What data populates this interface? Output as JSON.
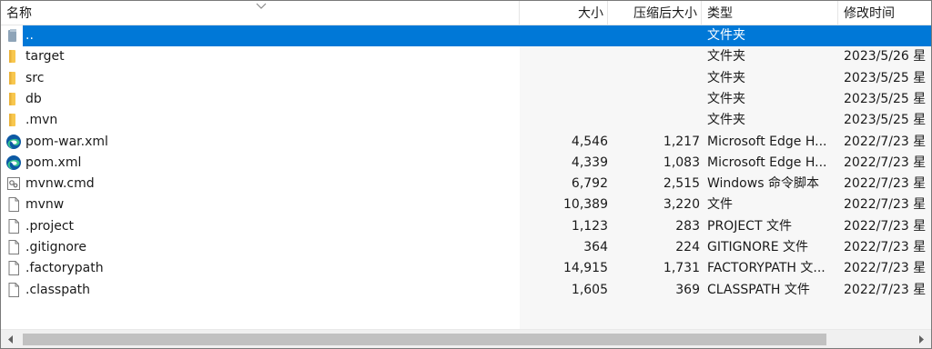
{
  "header": {
    "col_name": "名称",
    "col_size": "大小",
    "col_compressed": "压缩后大小",
    "col_type": "类型",
    "col_modified": "修改时间"
  },
  "rows": [
    {
      "name": "..",
      "size": "",
      "compressed": "",
      "type": "文件夹",
      "modified": "",
      "icon": "parent-folder-icon",
      "selected": true
    },
    {
      "name": "target",
      "size": "",
      "compressed": "",
      "type": "文件夹",
      "modified": "2023/5/26 星",
      "icon": "folder-icon"
    },
    {
      "name": "src",
      "size": "",
      "compressed": "",
      "type": "文件夹",
      "modified": "2023/5/25 星",
      "icon": "folder-icon"
    },
    {
      "name": "db",
      "size": "",
      "compressed": "",
      "type": "文件夹",
      "modified": "2023/5/25 星",
      "icon": "folder-icon"
    },
    {
      "name": ".mvn",
      "size": "",
      "compressed": "",
      "type": "文件夹",
      "modified": "2023/5/25 星",
      "icon": "folder-icon"
    },
    {
      "name": "pom-war.xml",
      "size": "4,546",
      "compressed": "1,217",
      "type": "Microsoft Edge H...",
      "modified": "2022/7/23 星",
      "icon": "edge-icon"
    },
    {
      "name": "pom.xml",
      "size": "4,339",
      "compressed": "1,083",
      "type": "Microsoft Edge H...",
      "modified": "2022/7/23 星",
      "icon": "edge-icon"
    },
    {
      "name": "mvnw.cmd",
      "size": "6,792",
      "compressed": "2,515",
      "type": "Windows 命令脚本",
      "modified": "2022/7/23 星",
      "icon": "script-icon"
    },
    {
      "name": "mvnw",
      "size": "10,389",
      "compressed": "3,220",
      "type": "文件",
      "modified": "2022/7/23 星",
      "icon": "file-icon"
    },
    {
      "name": ".project",
      "size": "1,123",
      "compressed": "283",
      "type": "PROJECT 文件",
      "modified": "2022/7/23 星",
      "icon": "file-icon"
    },
    {
      "name": ".gitignore",
      "size": "364",
      "compressed": "224",
      "type": "GITIGNORE 文件",
      "modified": "2022/7/23 星",
      "icon": "file-icon"
    },
    {
      "name": ".factorypath",
      "size": "14,915",
      "compressed": "1,731",
      "type": "FACTORYPATH 文...",
      "modified": "2022/7/23 星",
      "icon": "file-icon"
    },
    {
      "name": ".classpath",
      "size": "1,605",
      "compressed": "369",
      "type": "CLASSPATH 文件",
      "modified": "2022/7/23 星",
      "icon": "file-icon"
    }
  ],
  "colors": {
    "selection": "#0078d7",
    "folder": "#f8c74e",
    "edge_blue": "#0c59a4",
    "edge_green": "#34c38f"
  },
  "scrollbar": {
    "icons": [
      "scroll-left-icon",
      "scroll-right-icon"
    ]
  }
}
